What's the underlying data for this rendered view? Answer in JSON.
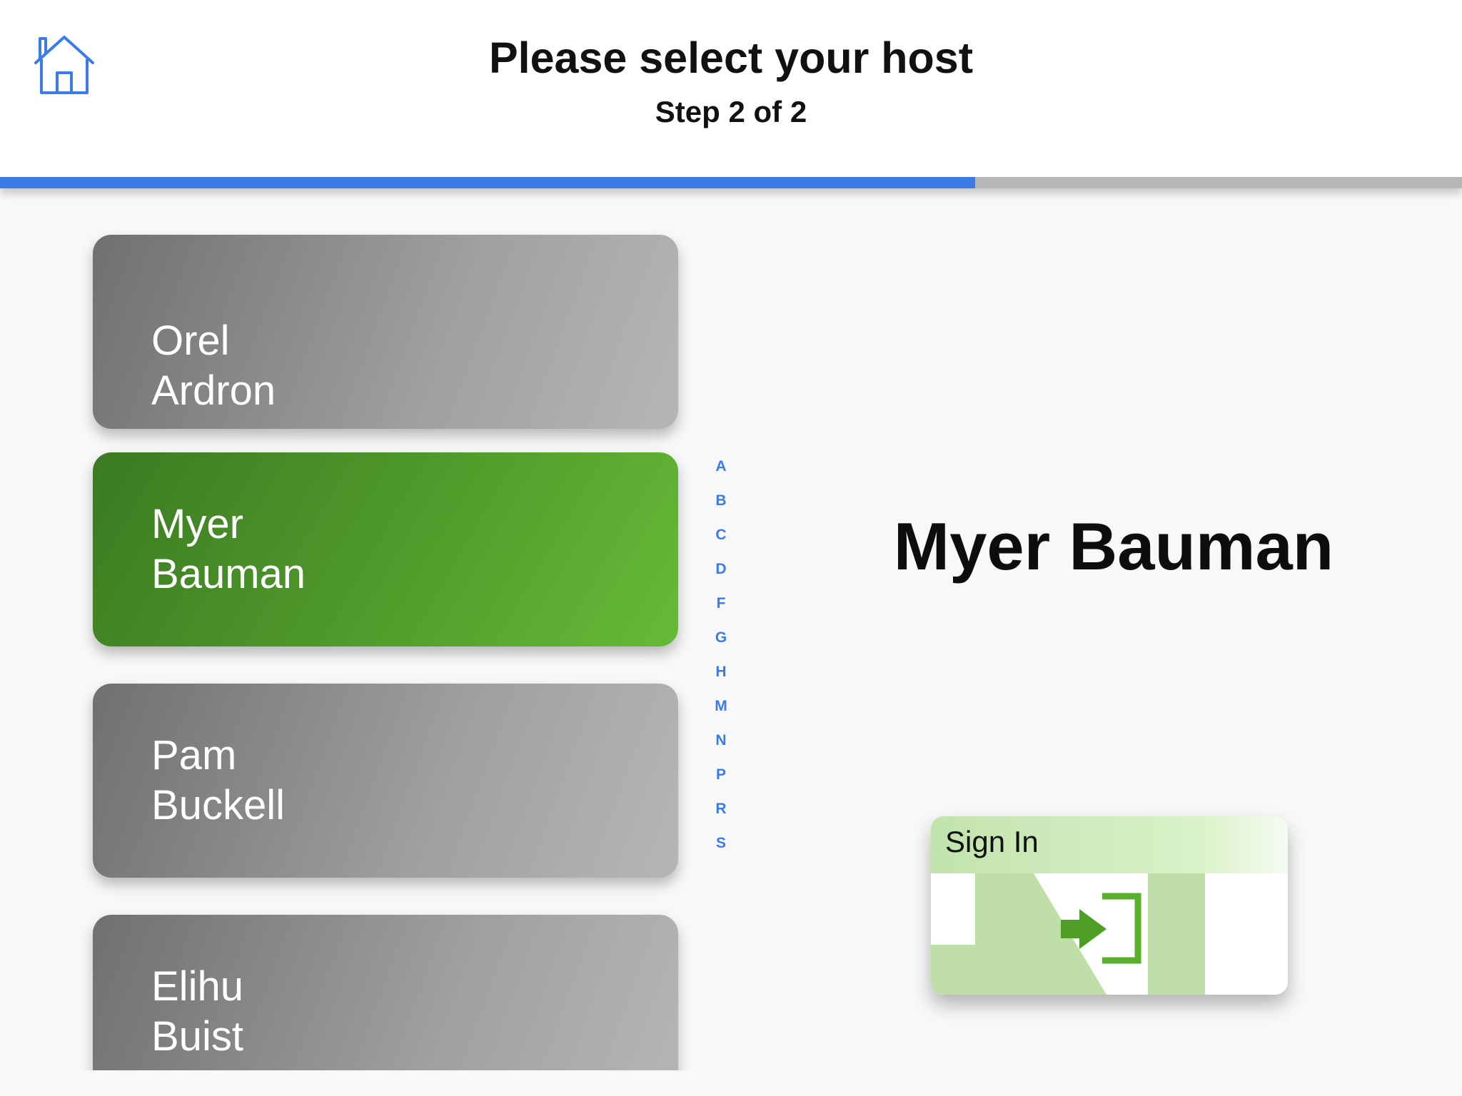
{
  "header": {
    "title": "Please select your host",
    "subtitle": "Step 2 of 2",
    "home_icon": "home-icon",
    "accent_color": "#3a7bea"
  },
  "progress": {
    "fraction": 0.667,
    "fill_color": "#3a7bea",
    "track_color": "#b6b6b6"
  },
  "hosts": [
    {
      "first": "Orel",
      "last": "Ardron",
      "selected": false
    },
    {
      "first": "Myer",
      "last": "Bauman",
      "selected": true
    },
    {
      "first": "Pam",
      "last": "Buckell",
      "selected": false
    },
    {
      "first": "Elihu",
      "last": "Buist",
      "selected": false
    }
  ],
  "index_letters": [
    "A",
    "B",
    "C",
    "D",
    "F",
    "G",
    "H",
    "M",
    "N",
    "P",
    "R",
    "S"
  ],
  "selected_host": {
    "name": "Myer Bauman"
  },
  "sign_in": {
    "label": "Sign In",
    "icon": "sign-in-icon",
    "color": "#5ab02c"
  }
}
